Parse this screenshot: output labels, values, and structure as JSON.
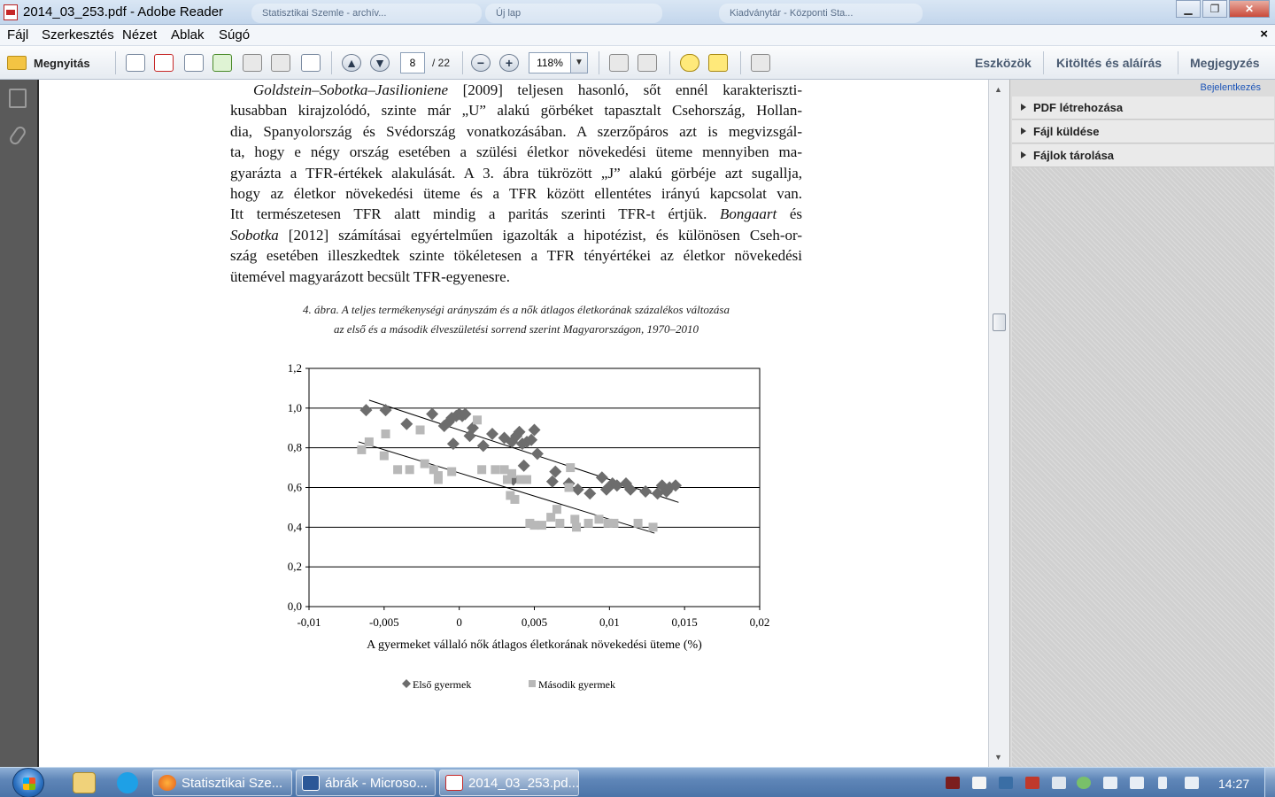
{
  "window": {
    "title": "2014_03_253.pdf - Adobe Reader",
    "ghost_tabs": [
      "Statisztikai Szemle - archív...",
      "Új lap",
      "Kiadványtár - Központi Sta..."
    ],
    "minimize": "▁",
    "restore": "❐",
    "close": "✕"
  },
  "menu": {
    "items": [
      "Fájl",
      "Szerkesztés",
      "Nézet",
      "Ablak",
      "Súgó"
    ],
    "close_doc": "×"
  },
  "toolbar": {
    "open_label": "Megnyitás",
    "page_current": "8",
    "page_total": "/ 22",
    "zoom_out": "−",
    "zoom_in": "+",
    "prev_page": "▲",
    "next_page": "▼",
    "zoom_value": "118%",
    "zoom_dropdown": "▼",
    "tools": "Eszközök",
    "fill_sign": "Kitöltés és aláírás",
    "comment": "Megjegyzés"
  },
  "right_panel": {
    "login": "Bejelentkezés",
    "items": [
      "PDF létrehozása",
      "Fájl küldése",
      "Fájlok tárolása"
    ]
  },
  "document": {
    "lines": [
      "Goldstein–Sobotka–Jasilioniene [2009] teljesen hasonló, sőt ennél karakteriszti-",
      "kusabban kirajzolódó, szinte már „U” alakú görbéket tapasztalt Csehország, Hollan-",
      "dia, Spanyolország és Svédország vonatkozásában. A szerzőpáros azt is megvizsgál-",
      "ta, hogy e négy ország esetében a szülési életkor növekedési üteme mennyiben ma-",
      "gyarázta a TFR-értékek alakulását. A 3. ábra tükrözött „J” alakú görbéje azt sugallja,",
      "hogy az életkor növekedési üteme és a TFR között ellentétes irányú kapcsolat van.",
      "Itt természetesen TFR alatt mindig a paritás szerinti TFR-t értjük. Bongaart és",
      "Sobotka [2012] számításai egyértelműen igazolták a hipotézist, és különösen Cseh-or-",
      "szág esetében illeszkedtek szinte tökéletesen a TFR tényértékei az életkor növekedési",
      "ütemével magyarázott becsült TFR-egyenesre."
    ],
    "caption_line1": "4. ábra. A teljes termékenységi arányszám és a nők átlagos életkorának százalékos változása",
    "caption_line2": "az első és a második élveszületési sorrend szerint Magyarországon, 1970–2010"
  },
  "chart_data": {
    "type": "scatter",
    "title": "",
    "xlabel": "A gyermeket vállaló nők átlagos életkorának növekedési üteme (%)",
    "ylabel": "",
    "xlim": [
      -0.01,
      0.02
    ],
    "ylim": [
      0,
      1.2
    ],
    "x_ticks": [
      "-0,01",
      "-0,005",
      "0",
      "0,005",
      "0,01",
      "0,015",
      "0,02"
    ],
    "y_ticks": [
      "0,0",
      "0,2",
      "0,4",
      "0,6",
      "0,8",
      "1,0",
      "1,2"
    ],
    "grid": "horizontal",
    "legend_position": "bottom",
    "series": [
      {
        "name": "Első gyermek",
        "color": "#6d6d6d",
        "marker": "diamond",
        "trendline": [
          [
            -0.006,
            1.04
          ],
          [
            0.0146,
            0.525
          ]
        ],
        "points": [
          [
            -0.0062,
            0.99
          ],
          [
            -0.0049,
            0.99
          ],
          [
            -0.0035,
            0.92
          ],
          [
            -0.0018,
            0.97
          ],
          [
            -0.001,
            0.91
          ],
          [
            -0.0007,
            0.93
          ],
          [
            -0.0004,
            0.82
          ],
          [
            -0.0005,
            0.95
          ],
          [
            -0.0002,
            0.96
          ],
          [
            0.0,
            0.97
          ],
          [
            0.0002,
            0.96
          ],
          [
            0.0004,
            0.97
          ],
          [
            0.0007,
            0.86
          ],
          [
            0.0009,
            0.9
          ],
          [
            0.0016,
            0.81
          ],
          [
            0.0022,
            0.87
          ],
          [
            0.003,
            0.85
          ],
          [
            0.0035,
            0.83
          ],
          [
            0.0038,
            0.86
          ],
          [
            0.004,
            0.88
          ],
          [
            0.0042,
            0.82
          ],
          [
            0.0045,
            0.83
          ],
          [
            0.0048,
            0.84
          ],
          [
            0.005,
            0.89
          ],
          [
            0.0052,
            0.77
          ],
          [
            0.0036,
            0.64
          ],
          [
            0.0043,
            0.71
          ],
          [
            0.0062,
            0.63
          ],
          [
            0.0064,
            0.68
          ],
          [
            0.0073,
            0.62
          ],
          [
            0.0079,
            0.59
          ],
          [
            0.0087,
            0.57
          ],
          [
            0.0095,
            0.65
          ],
          [
            0.0098,
            0.59
          ],
          [
            0.0102,
            0.62
          ],
          [
            0.0105,
            0.61
          ],
          [
            0.0111,
            0.62
          ],
          [
            0.0114,
            0.59
          ],
          [
            0.0124,
            0.58
          ],
          [
            0.0132,
            0.57
          ],
          [
            0.0135,
            0.61
          ],
          [
            0.0138,
            0.58
          ],
          [
            0.014,
            0.6
          ],
          [
            0.0144,
            0.61
          ]
        ]
      },
      {
        "name": "Második gyermek",
        "color": "#b8b8b8",
        "marker": "square",
        "trendline": [
          [
            -0.0067,
            0.83
          ],
          [
            0.013,
            0.37
          ]
        ],
        "points": [
          [
            -0.0065,
            0.79
          ],
          [
            -0.006,
            0.83
          ],
          [
            -0.005,
            0.76
          ],
          [
            -0.0049,
            0.87
          ],
          [
            -0.0041,
            0.69
          ],
          [
            -0.0033,
            0.69
          ],
          [
            -0.0026,
            0.89
          ],
          [
            -0.0023,
            0.72
          ],
          [
            -0.0017,
            0.69
          ],
          [
            -0.0014,
            0.66
          ],
          [
            -0.0014,
            0.64
          ],
          [
            -0.0005,
            0.68
          ],
          [
            0.0012,
            0.94
          ],
          [
            0.0015,
            0.69
          ],
          [
            0.0024,
            0.69
          ],
          [
            0.003,
            0.69
          ],
          [
            0.0032,
            0.64
          ],
          [
            0.0034,
            0.56
          ],
          [
            0.0035,
            0.67
          ],
          [
            0.0037,
            0.54
          ],
          [
            0.0041,
            0.64
          ],
          [
            0.0045,
            0.64
          ],
          [
            0.0047,
            0.42
          ],
          [
            0.005,
            0.41
          ],
          [
            0.0055,
            0.41
          ],
          [
            0.0061,
            0.45
          ],
          [
            0.0065,
            0.49
          ],
          [
            0.0067,
            0.42
          ],
          [
            0.0073,
            0.6
          ],
          [
            0.0074,
            0.7
          ],
          [
            0.0077,
            0.44
          ],
          [
            0.0078,
            0.4
          ],
          [
            0.0086,
            0.42
          ],
          [
            0.0093,
            0.44
          ],
          [
            0.0099,
            0.42
          ],
          [
            0.0103,
            0.42
          ],
          [
            0.0119,
            0.42
          ],
          [
            0.0129,
            0.4
          ]
        ]
      }
    ]
  },
  "taskbar": {
    "tasks": [
      "Statisztikai Sze...",
      "ábrák - Microso...",
      "2014_03_253.pd..."
    ],
    "clock": "14:27"
  }
}
